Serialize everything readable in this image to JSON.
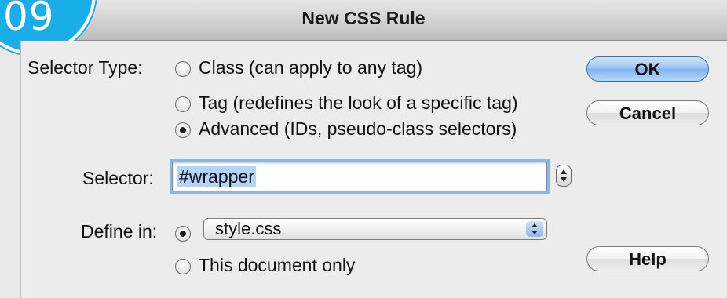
{
  "step_badge": {
    "number": "09",
    "color": "#19aee8"
  },
  "window": {
    "title": "New CSS Rule"
  },
  "selector_type": {
    "label": "Selector Type:",
    "options": [
      {
        "label": "Class (can apply to any tag)",
        "checked": false
      },
      {
        "label": "Tag (redefines the look of a specific tag)",
        "checked": false
      },
      {
        "label": "Advanced (IDs, pseudo-class selectors)",
        "checked": true
      }
    ]
  },
  "selector": {
    "label": "Selector:",
    "value": "#wrapper"
  },
  "define_in": {
    "label": "Define in:",
    "file_option_checked": true,
    "selected_file": "style.css",
    "document_option_label": "This document only",
    "document_option_checked": false
  },
  "buttons": {
    "ok": "OK",
    "cancel": "Cancel",
    "help": "Help"
  }
}
